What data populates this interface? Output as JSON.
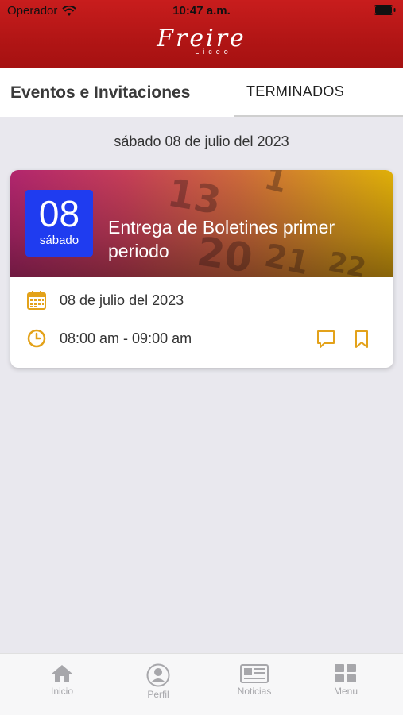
{
  "status_bar": {
    "carrier": "Operador",
    "time": "10:47 a.m."
  },
  "header": {
    "brand_name": "Freire",
    "brand_sub": "Liceo",
    "header_color": "#b91818"
  },
  "tabs": {
    "active": "Eventos e Invitaciones",
    "inactive": "TERMINADOS"
  },
  "date_heading": "sábado 08 de julio del 2023",
  "event": {
    "badge_day": "08",
    "badge_weekday": "sábado",
    "title": "Entrega de Boletines primer periodo",
    "date_text": "08 de julio del 2023",
    "time_text": "08:00 am - 09:00 am",
    "badge_color": "#1f3cf0",
    "icon_color": "#e3a21a",
    "icons": {
      "date": "calendar-icon",
      "time": "clock-icon",
      "comment": "comment-icon",
      "save": "bookmark-icon"
    }
  },
  "tabbar": {
    "items": [
      {
        "label": "Inicio",
        "icon": "home-icon"
      },
      {
        "label": "Perfil",
        "icon": "profile-icon"
      },
      {
        "label": "Noticias",
        "icon": "news-icon"
      },
      {
        "label": "Menu",
        "icon": "grid-icon"
      }
    ]
  }
}
